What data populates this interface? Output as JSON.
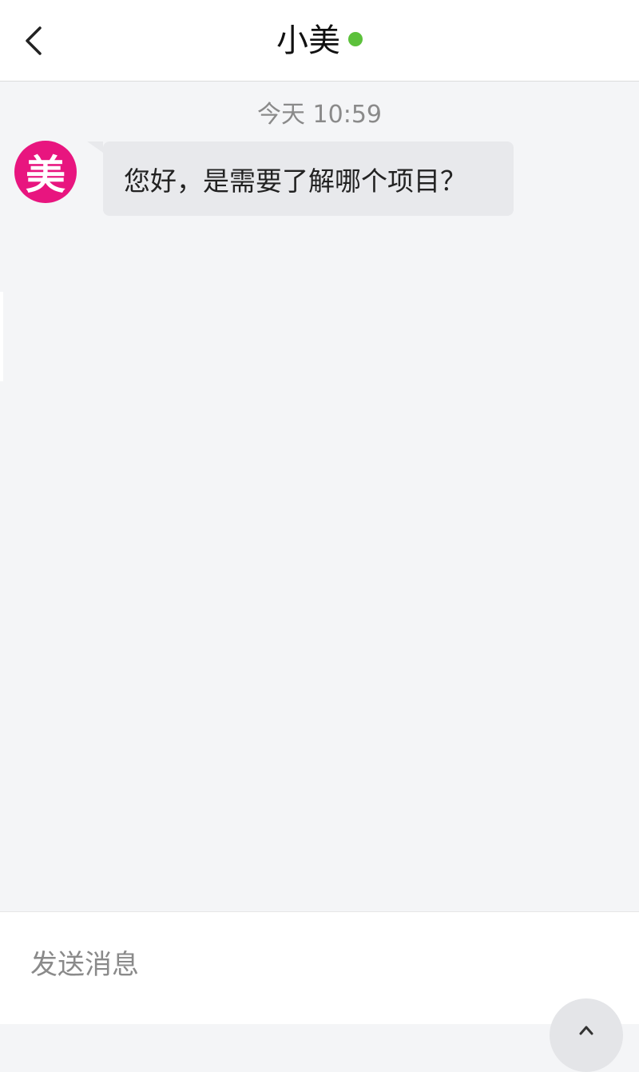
{
  "header": {
    "title": "小美",
    "online_color": "#5cc13b",
    "back_icon": "chevron-left-icon"
  },
  "chat": {
    "timestamp": "今天 10:59",
    "messages": [
      {
        "sender": "agent",
        "avatar_text": "美",
        "avatar_color": "#e8157f",
        "text": "您好，是需要了解哪个项目？"
      }
    ]
  },
  "composer": {
    "placeholder": "发送消息",
    "value": "",
    "send_icon": "send-icon"
  }
}
